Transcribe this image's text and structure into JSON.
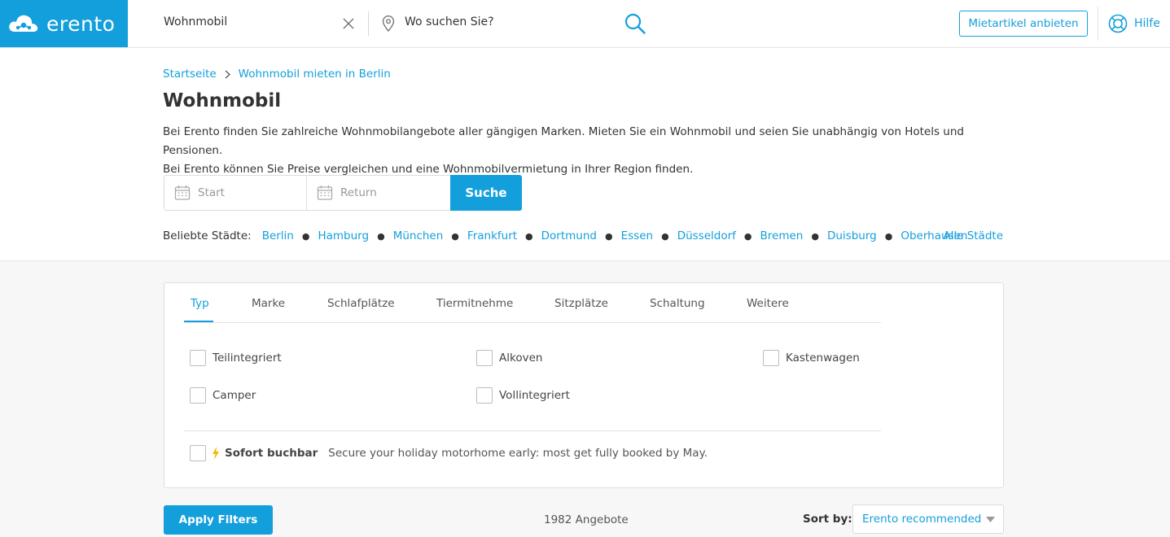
{
  "header": {
    "logo_text": "erento",
    "search_what": "Wohnmobil",
    "where_placeholder": "Wo suchen Sie?",
    "offer_button": "Mietartikel anbieten",
    "help_label": "Hilfe"
  },
  "breadcrumb": {
    "home": "Startseite",
    "current": "Wohnmobil mieten in Berlin"
  },
  "page": {
    "title": "Wohnmobil",
    "intro_line1": "Bei Erento finden Sie zahlreiche Wohnmobilangebote aller gängigen Marken. Mieten Sie ein Wohnmobil und seien Sie unabhängig von Hotels und Pensionen.",
    "intro_line2": "Bei Erento können Sie Preise vergleichen und eine Wohnmobilvermietung in Ihrer Region finden."
  },
  "booking": {
    "start_placeholder": "Start",
    "return_placeholder": "Return",
    "search_button": "Suche"
  },
  "cities": {
    "label": "Beliebte Städte:",
    "items": [
      "Berlin",
      "Hamburg",
      "München",
      "Frankfurt",
      "Dortmund",
      "Essen",
      "Düsseldorf",
      "Bremen",
      "Duisburg",
      "Oberhausen"
    ],
    "all_link": "Alle Städte"
  },
  "filters": {
    "tabs": [
      "Typ",
      "Marke",
      "Schlafplätze",
      "Tiermitnehme",
      "Sitzplätze",
      "Schaltung",
      "Weitere"
    ],
    "active_tab": "Typ",
    "options": [
      "Teilintegriert",
      "Alkoven",
      "Kastenwagen",
      "Camper",
      "Vollintegriert"
    ],
    "instant_label": "Sofort buchbar",
    "instant_desc": "Secure your holiday motorhome early: most get fully booked by May."
  },
  "results": {
    "apply_button": "Apply Filters",
    "count": "1982 Angebote",
    "sort_label": "Sort by:",
    "sort_value": "Erento recommended"
  },
  "colors": {
    "brand": "#139fdc",
    "bolt": "#f5b800"
  }
}
